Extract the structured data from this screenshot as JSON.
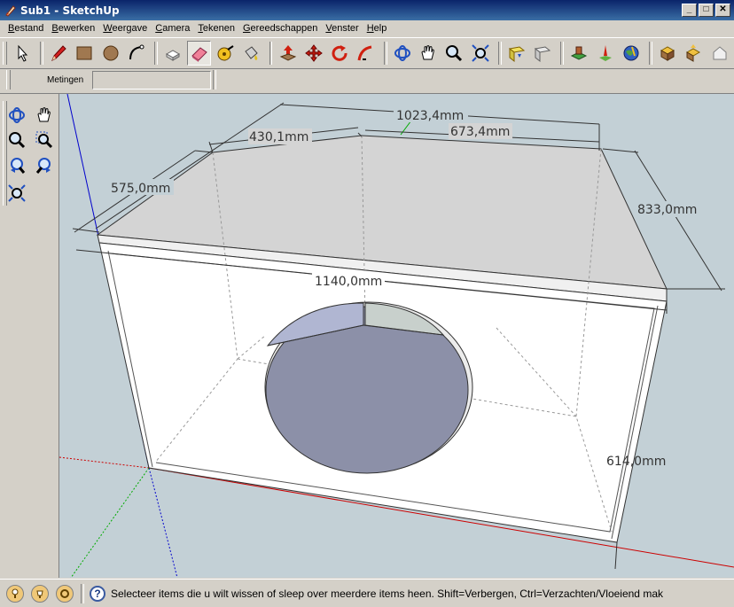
{
  "window": {
    "title": "Sub1 - SketchUp"
  },
  "menu": [
    {
      "first": "B",
      "rest": "estand"
    },
    {
      "first": "B",
      "rest": "ewerken"
    },
    {
      "first": "W",
      "rest": "eergave"
    },
    {
      "first": "C",
      "rest": "amera"
    },
    {
      "first": "T",
      "rest": "ekenen"
    },
    {
      "first": "G",
      "rest": "ereedschappen"
    },
    {
      "first": "V",
      "rest": "enster"
    },
    {
      "first": "H",
      "rest": "elp"
    }
  ],
  "toolbar": {
    "tools": [
      "select-icon",
      "pencil-icon",
      "rectangle-icon",
      "circle-icon",
      "arc-icon",
      "make-component-icon",
      "eraser-icon",
      "tape-measure-icon",
      "paint-bucket-icon",
      "push-pull-icon",
      "move-icon",
      "rotate-icon",
      "follow-me-icon",
      "orbit-icon",
      "pan-icon",
      "zoom-icon",
      "zoom-extents-icon",
      "get-models-icon",
      "share-model-icon",
      "place-model-icon",
      "add-location-icon",
      "google-earth-icon",
      "get-components-icon",
      "share-component-icon",
      "warehouse-icon"
    ],
    "active_tool": "eraser-icon"
  },
  "measurements": {
    "label": "Metingen",
    "value": ""
  },
  "viewpanel": {
    "tools": [
      "orbit-icon",
      "pan-icon",
      "zoom-icon",
      "zoom-window-icon",
      "previous-view-icon",
      "next-view-icon",
      "zoom-extents-icon"
    ]
  },
  "model": {
    "dimensions": {
      "d1": "1023,4mm",
      "d2": "430,1mm",
      "d3": "673,4mm",
      "d4": "575,0mm",
      "d5": "833,0mm",
      "d6": "1140,0mm",
      "d7": "614,0mm"
    },
    "colors": {
      "background": "#c3d0d6",
      "top": "#d4d4d4",
      "front": "#ffffff",
      "hole": "#8c90a8",
      "hole_inner": "#b0b6d2",
      "axis_red": "#cc0000",
      "axis_green": "#00aa00",
      "axis_blue": "#0000cc"
    }
  },
  "statusbar": {
    "icons": [
      "geo-location-icon",
      "credits-icon",
      "user-icon"
    ],
    "help_icon": "?",
    "text": "Selecteer items die u wilt wissen of sleep over meerdere items heen. Shift=Verbergen, Ctrl=Verzachten/Vloeiend mak"
  }
}
